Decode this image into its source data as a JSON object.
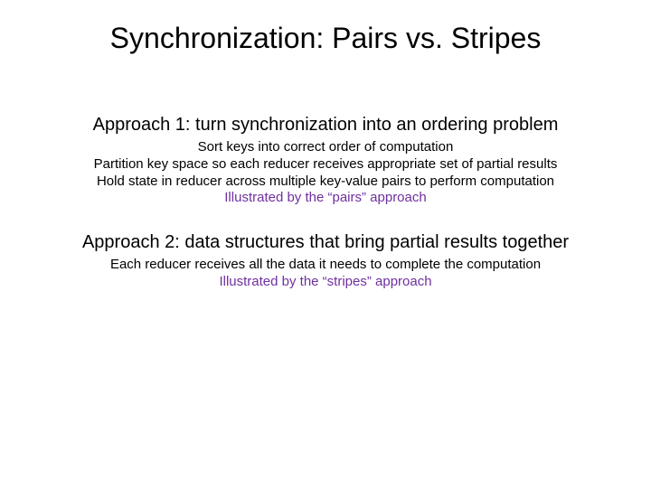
{
  "title": "Synchronization: Pairs vs. Stripes",
  "approach1": {
    "heading": "Approach 1: turn synchronization into an ordering problem",
    "lines": [
      "Sort keys into correct order of computation",
      "Partition key space so each reducer receives appropriate set of partial results",
      "Hold state in reducer across multiple key-value pairs to perform computation"
    ],
    "highlight": "Illustrated by the “pairs” approach"
  },
  "approach2": {
    "heading": "Approach 2: data structures that bring partial results together",
    "lines": [
      "Each reducer receives all the data it needs to complete the computation"
    ],
    "highlight": "Illustrated by the “stripes” approach"
  }
}
